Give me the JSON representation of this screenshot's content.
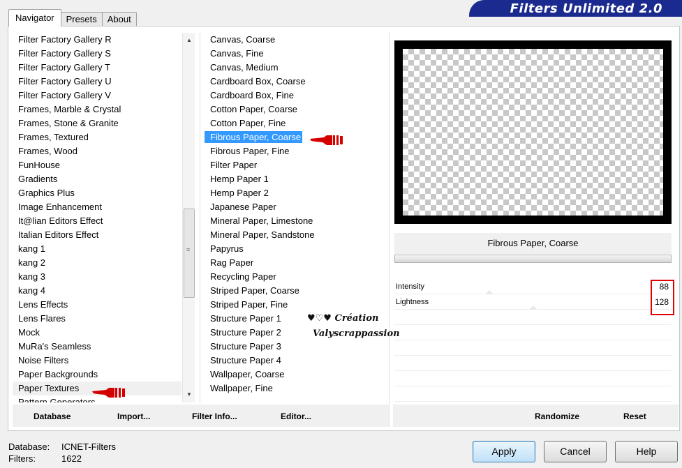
{
  "tabs": [
    {
      "label": "Navigator"
    },
    {
      "label": "Presets"
    },
    {
      "label": "About"
    }
  ],
  "banner": {
    "title": "Filters Unlimited 2.0"
  },
  "categories": [
    "Filter Factory Gallery R",
    "Filter Factory Gallery S",
    "Filter Factory Gallery T",
    "Filter Factory Gallery U",
    "Filter Factory Gallery V",
    "Frames, Marble & Crystal",
    "Frames, Stone & Granite",
    "Frames, Textured",
    "Frames, Wood",
    "FunHouse",
    "Gradients",
    "Graphics Plus",
    "Image Enhancement",
    "It@lian Editors Effect",
    "Italian Editors Effect",
    "kang 1",
    "kang 2",
    "kang 3",
    "kang 4",
    "Lens Effects",
    "Lens Flares",
    "Mock",
    "MuRa's Seamless",
    "Noise Filters",
    "Paper Backgrounds",
    "Paper Textures",
    "Pattern Generators"
  ],
  "selected_category": "Paper Textures",
  "filters": [
    "Canvas, Coarse",
    "Canvas, Fine",
    "Canvas, Medium",
    "Cardboard Box, Coarse",
    "Cardboard Box, Fine",
    "Cotton Paper, Coarse",
    "Cotton Paper, Fine",
    "Fibrous Paper, Coarse",
    "Fibrous Paper, Fine",
    "Filter Paper",
    "Hemp Paper 1",
    "Hemp Paper 2",
    "Japanese Paper",
    "Mineral Paper, Limestone",
    "Mineral Paper, Sandstone",
    "Papyrus",
    "Rag Paper",
    "Recycling Paper",
    "Striped Paper, Coarse",
    "Striped Paper, Fine",
    "Structure Paper 1",
    "Structure Paper 2",
    "Structure Paper 3",
    "Structure Paper 4",
    "Wallpaper, Coarse",
    "Wallpaper, Fine"
  ],
  "selected_filter": "Fibrous Paper, Coarse",
  "preview": {
    "filter_name": "Fibrous Paper, Coarse"
  },
  "params": [
    {
      "label": "Intensity",
      "value": "88",
      "level": 88
    },
    {
      "label": "Lightness",
      "value": "128",
      "level": 128
    }
  ],
  "left_buttons": [
    {
      "label": "Database"
    },
    {
      "label": "Import..."
    },
    {
      "label": "Filter Info..."
    },
    {
      "label": "Editor..."
    }
  ],
  "right_buttons": [
    {
      "label": "Randomize"
    },
    {
      "label": "Reset"
    }
  ],
  "status": {
    "database_label": "Database:",
    "database_value": "ICNET-Filters",
    "filters_label": "Filters:",
    "filters_value": "1622"
  },
  "dialog_buttons": {
    "apply": "Apply",
    "cancel": "Cancel",
    "help": "Help"
  },
  "watermark": {
    "line1": "♥♡♥ Création",
    "line2": "Valyscrappassion"
  },
  "colors": {
    "selection": "#3399ff",
    "banner": "#1a2a8e",
    "highlight_box": "#e00000",
    "pointer_hand": "#d40000"
  }
}
